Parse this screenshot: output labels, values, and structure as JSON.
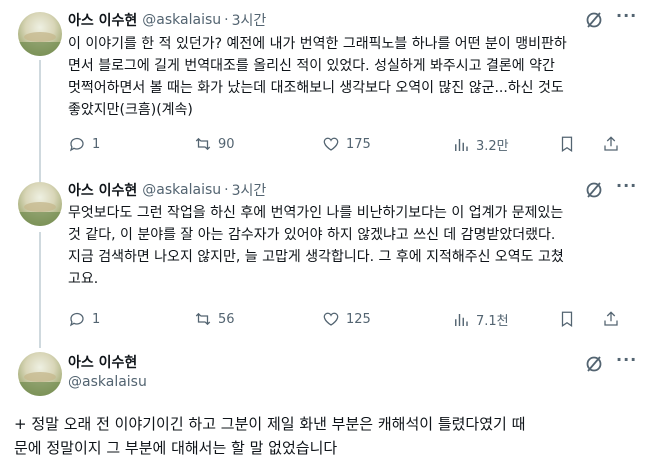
{
  "tweets": [
    {
      "name": "아스 이수현",
      "handle": "@askalaisu",
      "separator": "·",
      "time": "3시간",
      "text": "이 이야기를 한 적 있던가? 예전에 내가 번역한 그래픽노블 하나를 어떤 분이 맹비판하\n면서 블로그에 길게 번역대조를 올리신 적이 있었다. 성실하게 봐주시고 결론에 약간\n멋쩍어하면서 볼 때는 화가 났는데 대조해보니 생각보다 오역이 많진 않군...하신 것도\n좋았지만(크흠)(계속)",
      "replies": "1",
      "retweets": "90",
      "likes": "175",
      "views": "3.2만"
    },
    {
      "name": "아스 이수현",
      "handle": "@askalaisu",
      "separator": "·",
      "time": "3시간",
      "text": "무엇보다도 그런 작업을 하신 후에 번역가인 나를 비난하기보다는 이 업계가 문제있는\n것 같다, 이 분야를 잘 아는 감수자가 있어야 하지 않겠냐고 쓰신 데 감명받았더랬다.\n지금 검색하면 나오지 않지만, 늘 고맙게 생각합니다. 그 후에 지적해주신 오역도 고쳤\n고요.",
      "replies": "1",
      "retweets": "56",
      "likes": "125",
      "views": "7.1천"
    },
    {
      "name": "아스 이수현",
      "handle": "@askalaisu",
      "text": "+ 정말 오래 전 이야기이긴 하고 그분이 제일 화낸 부분은 캐해석이 틀렸다였기 때\n문에 정말이지 그 부분에 대해서는 할 말 없었습니다"
    }
  ],
  "icons": {
    "reply": "speech-bubble-icon",
    "retweet": "retweet-arrows-icon",
    "like": "heart-icon",
    "views": "bar-chart-icon",
    "share": "share-upload-icon",
    "bookmark": "bookmark-icon",
    "grok": "grok-slash-icon",
    "more": "more-dots-icon"
  },
  "colors": {
    "text": "#0f1419",
    "secondary": "#536471",
    "thread_line": "#cfd9de"
  }
}
